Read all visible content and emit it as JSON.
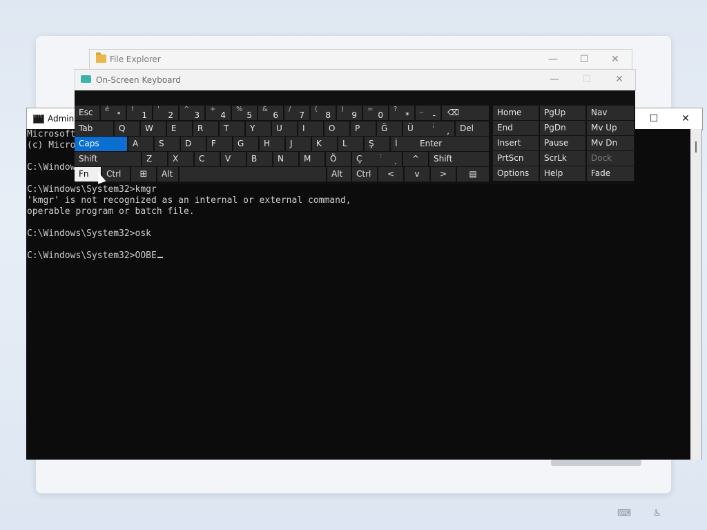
{
  "file_explorer": {
    "title": "File Explorer"
  },
  "osk": {
    "title": "On-Screen Keyboard",
    "row1": {
      "esc": "Esc",
      "keys": [
        {
          "sh": "é",
          "mn": "\""
        },
        {
          "sh": "!",
          "mn": "1"
        },
        {
          "sh": "'",
          "mn": "2"
        },
        {
          "sh": "^",
          "mn": "3"
        },
        {
          "sh": "+",
          "mn": "4"
        },
        {
          "sh": "%",
          "mn": "5"
        },
        {
          "sh": "&",
          "mn": "6"
        },
        {
          "sh": "/",
          "mn": "7"
        },
        {
          "sh": "(",
          "mn": "8"
        },
        {
          "sh": ")",
          "mn": "9"
        },
        {
          "sh": "=",
          "mn": "0"
        },
        {
          "sh": "?",
          "mn": "*"
        },
        {
          "sh": "_",
          "mn": "-"
        }
      ],
      "backspace": "⌫"
    },
    "row2": {
      "tab": "Tab",
      "keys": [
        "Q",
        "W",
        "E",
        "R",
        "T",
        "Y",
        "U",
        "I",
        "O",
        "P",
        "Ğ",
        "Ü"
      ],
      "punct": {
        "sh": ";",
        "mn": ","
      },
      "del": "Del",
      "i_under": ","
    },
    "row3": {
      "caps": "Caps",
      "keys": [
        "A",
        "S",
        "D",
        "F",
        "G",
        "H",
        "J",
        "K",
        "L",
        "Ş",
        "İ"
      ],
      "extra": ";",
      "enter": "Enter"
    },
    "row4": {
      "shift": "Shift",
      "keys": [
        "Z",
        "X",
        "C",
        "V",
        "B",
        "N",
        "M",
        "Ö",
        "Ç"
      ],
      "punct": {
        "sh": ":",
        "mn": "."
      },
      "up": "^",
      "shift_r": "Shift"
    },
    "row5": {
      "fn": "Fn",
      "ctrl": "Ctrl",
      "alt": "Alt",
      "altr": "Alt",
      "ctrlr": "Ctrl",
      "left": "<",
      "down": "v",
      "right": ">"
    },
    "nav": {
      "col1": [
        "Home",
        "End",
        "Insert",
        "PrtScn",
        "Options"
      ],
      "col2": [
        "PgUp",
        "PgDn",
        "Pause",
        "ScrLk",
        "Help"
      ],
      "col3": [
        "Nav",
        "Mv Up",
        "Mv Dn",
        "Dock",
        "Fade"
      ]
    }
  },
  "cmd": {
    "title": "Admini",
    "lines": [
      "Microsoft",
      "(c) Micro",
      "",
      "C:\\Window",
      "",
      "C:\\Windows\\System32>kmgr",
      "'kmgr' is not recognized as an internal or external command,",
      "operable program or batch file.",
      "",
      "C:\\Windows\\System32>osk",
      "",
      "C:\\Windows\\System32>OOBE"
    ]
  },
  "window_controls": {
    "minimize": "—",
    "maximize": "☐",
    "close": "✕"
  },
  "taskbar": {
    "keyboard_icon": "⌨",
    "accessibility_icon": "♿"
  }
}
